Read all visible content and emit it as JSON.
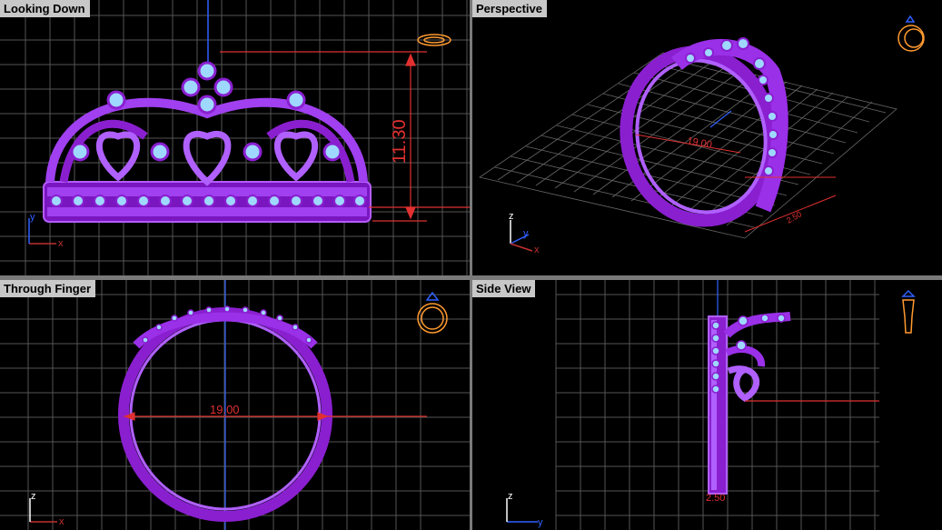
{
  "viewports": {
    "top_left": {
      "title": "Looking Down",
      "dimension": "11.30",
      "axis_a": "y",
      "axis_b": "x"
    },
    "top_right": {
      "title": "Perspective",
      "dimension": "19.00",
      "dimension2": "2.50",
      "axis_a": "z",
      "axis_b": "y",
      "axis_c": "x"
    },
    "bottom_left": {
      "title": "Through Finger",
      "dimension": "19.00",
      "axis_a": "z",
      "axis_b": "x"
    },
    "bottom_right": {
      "title": "Side View",
      "dimension": "2.50",
      "axis_a": "z",
      "axis_b": "y"
    }
  },
  "colors": {
    "grid": "#5a5a5a",
    "metal": "#8a1fd0",
    "gem": "#9fd8ff",
    "dimension": "#e03030",
    "axis_x": "#c03030",
    "axis_y": "#3060ff",
    "axis_z": "#ffffff",
    "thumbnail": "#ff9a30"
  }
}
